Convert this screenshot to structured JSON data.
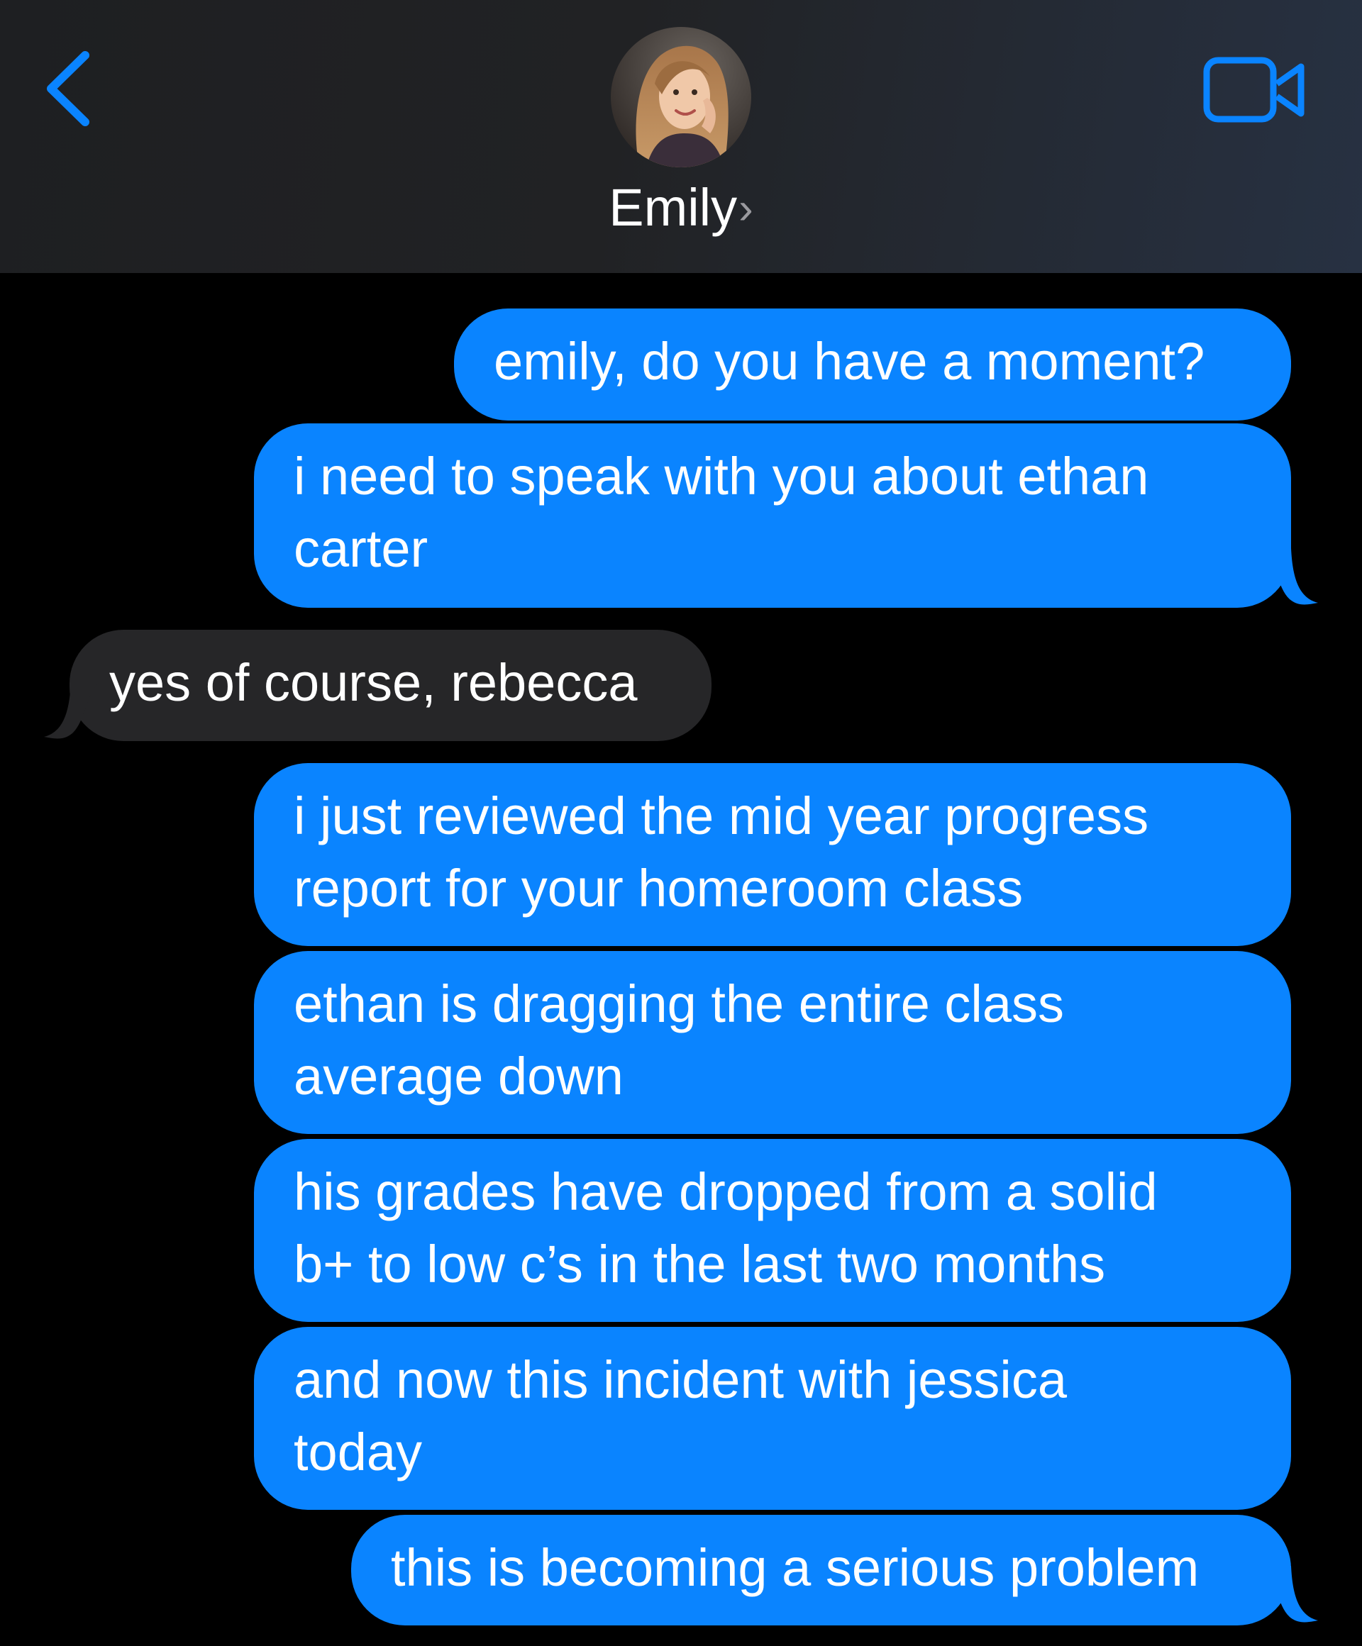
{
  "header": {
    "back_icon": "chevron-left-icon",
    "contact_name": "Emily",
    "contact_chevron": "›",
    "avatar_icon": "contact-avatar",
    "video_icon": "video-camera-icon",
    "accent_color": "#0a84ff"
  },
  "colors": {
    "background": "#000000",
    "header_background": "#212224",
    "sent_bubble": "#0a84ff",
    "received_bubble": "#262628",
    "text": "#ffffff"
  },
  "messages": [
    {
      "sender": "me",
      "lines": [
        "emily, do you have a moment?"
      ]
    },
    {
      "sender": "me",
      "lines": [
        "i need to speak with you about ethan",
        "carter"
      ]
    },
    {
      "sender": "them",
      "lines": [
        "yes of course, rebecca"
      ]
    },
    {
      "sender": "me",
      "lines": [
        "i just reviewed the mid year progress",
        "report for your homeroom class"
      ]
    },
    {
      "sender": "me",
      "lines": [
        "ethan is dragging the entire class",
        "average down"
      ]
    },
    {
      "sender": "me",
      "lines": [
        "his grades have dropped from a solid",
        "b+ to low c’s in the last two months"
      ]
    },
    {
      "sender": "me",
      "lines": [
        "and now this incident with jessica",
        "today"
      ]
    },
    {
      "sender": "me",
      "lines": [
        "this is becoming a serious problem"
      ]
    }
  ]
}
